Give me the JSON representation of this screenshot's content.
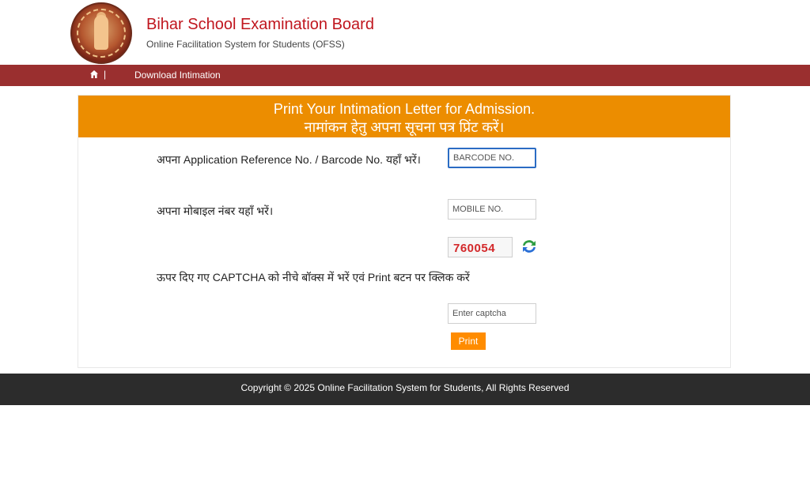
{
  "header": {
    "title": "Bihar School Examination Board",
    "subtitle": "Online Facilitation System for Students (OFSS)",
    "logo_icon": "bseb-emblem-icon"
  },
  "nav": {
    "home_icon": "home-icon",
    "separator": "|",
    "link_label": "Download Intimation"
  },
  "panel": {
    "heading_en": "Print Your Intimation Letter for Admission.",
    "heading_hi": "नामांकन हेतु अपना सूचना पत्र प्रिंट करें।",
    "fields": {
      "barcode_label": "अपना Application Reference No. / Barcode No. यहाँ भरें।",
      "barcode_placeholder": "BARCODE NO.",
      "mobile_label": "अपना मोबाइल नंबर यहाँ भरें।",
      "mobile_placeholder": "MOBILE NO.",
      "captcha_value": "760054",
      "captcha_label": "ऊपर दिए गए CAPTCHA को नीचे बॉक्स में भरें एवं Print बटन पर क्लिक करें",
      "captcha_placeholder": "Enter captcha"
    },
    "print_label": "Print"
  },
  "footer": {
    "text": "Copyright © 2025 Online Facilitation System for Students, All Rights Reserved"
  },
  "colors": {
    "title_red": "#c0161e",
    "nav_bg": "#9a2f2f",
    "panel_head_bg": "#ec8d00",
    "print_btn_bg": "#ff8c00",
    "footer_bg": "#2c2c2c",
    "captcha_red": "#d3282a"
  }
}
